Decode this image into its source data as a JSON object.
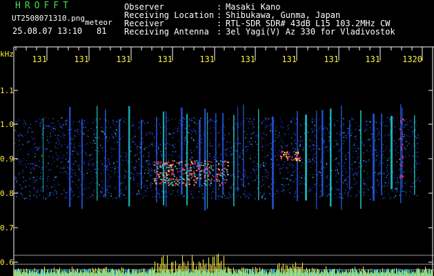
{
  "header": {
    "logo": "HROFFT",
    "file_name": "UT2508071310.png",
    "mode_label": "meteor",
    "date_time": "25.08.07 13:10",
    "count": "81",
    "fields": [
      {
        "label": "Observer",
        "sep": ":",
        "value": "Masaki Kano"
      },
      {
        "label": "Receiving Location",
        "sep": ":",
        "value": "Shibukawa, Gunma, Japan"
      },
      {
        "label": "Receiver",
        "sep": ":",
        "value": "RTL-SDR SDR# 43dB L15 103.2MHz CW"
      },
      {
        "label": "Receiving Antenna",
        "sep": ":",
        "value": "3el Yagi(V) Az 330 for Vladivostok"
      }
    ]
  },
  "spectrogram": {
    "y_unit": "kHz",
    "y_ticks": [
      "1.1",
      "1.0",
      "0.9",
      "0.8",
      "0.7",
      "0.6"
    ],
    "x_ticks": [
      "131",
      "131",
      "131",
      "131",
      "131",
      "131",
      "131",
      "131",
      "131",
      "1320"
    ],
    "colors": {
      "background": "#000000",
      "tick_label": "#ffef3a",
      "axis": "#ffffff",
      "noise_low": "#1d2fb0",
      "noise_mid": "#2a66ff",
      "echo_hot": "#ff2a6a",
      "echo_mid": "#27e0e0",
      "power_trace": "#ffef3a",
      "power_fill": "#26c7e6"
    }
  }
}
